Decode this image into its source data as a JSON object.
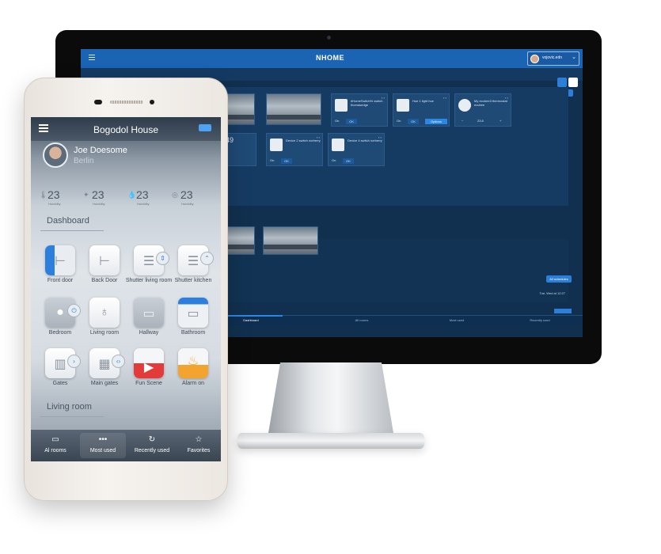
{
  "desktop": {
    "logo": "NHOME",
    "user_name": "vojovic.edn",
    "adjust_label": "Adjust",
    "cards": [
      {
        "text": "#HomeSwitch% switch thomasedge",
        "on": "On",
        "ok": "OK"
      },
      {
        "text": "Hue 1 light hue",
        "on": "On",
        "ok": "OK",
        "options": "Options"
      },
      {
        "text": "My ecobee3 thermostat ecobee",
        "minus": "−",
        "value": "23.8",
        "plus": "+"
      },
      {
        "text": "Device 2 switch norberry",
        "on": "On",
        "ok": "OK"
      },
      {
        "text": "Device 4 switch norberry",
        "on": "On",
        "ok": "OK"
      }
    ],
    "partial_text": "49",
    "all_schedules_label": "All schedules",
    "date_text": "Tue, Wed at 12:27",
    "bottom_tabs": [
      "Dashboard",
      "All rooms",
      "Most used",
      "Recently used"
    ]
  },
  "phone": {
    "title": "Bogodol House",
    "user": {
      "name": "Joe Doesome",
      "city": "Berlin"
    },
    "stats": [
      {
        "icon": "🌡",
        "value": "23",
        "label": "Humidity"
      },
      {
        "icon": "✦",
        "value": "23",
        "label": "Humidity"
      },
      {
        "icon": "💧",
        "value": "23",
        "label": "Humidity"
      },
      {
        "icon": "◎",
        "value": "23",
        "label": "Humidity"
      }
    ],
    "section_dashboard": "Dashboard",
    "section_living_room": "Living room",
    "tiles": [
      {
        "label": "Front door"
      },
      {
        "label": "Back Door"
      },
      {
        "label": "Shutter living room"
      },
      {
        "label": "Shutter kitchen"
      },
      {
        "label": "Bedroom"
      },
      {
        "label": "Living room"
      },
      {
        "label": "Hallway"
      },
      {
        "label": "Bathroom"
      },
      {
        "label": "Gates"
      },
      {
        "label": "Main gates"
      },
      {
        "label": "Fun Scene"
      },
      {
        "label": "Alarm on"
      }
    ],
    "nav": [
      {
        "icon": "▭",
        "label": "Al rooms"
      },
      {
        "icon": "•••",
        "label": "Most used"
      },
      {
        "icon": "↻",
        "label": "Recently used"
      },
      {
        "icon": "☆",
        "label": "Favorites"
      }
    ]
  },
  "colors": {
    "accent": "#2b7fd9",
    "desktop_bg": "#11304f",
    "topbar": "#1b63b3"
  }
}
